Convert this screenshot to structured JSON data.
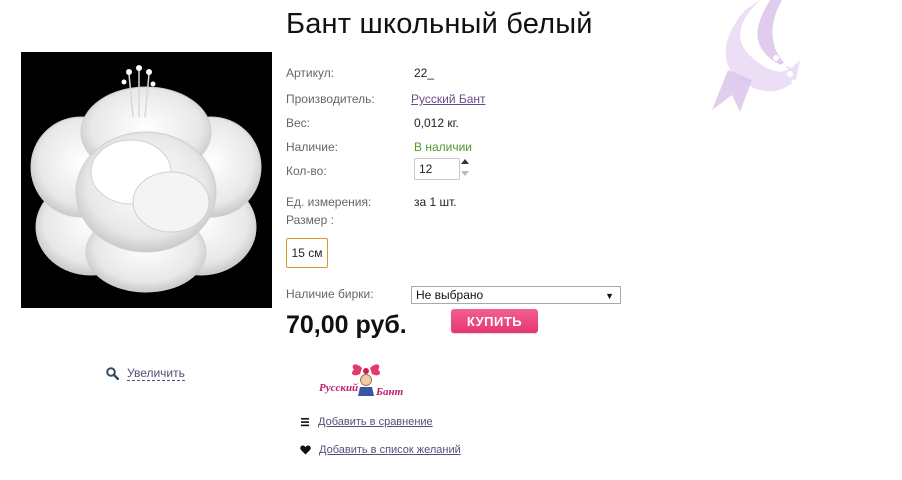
{
  "product": {
    "title": "Бант школьный белый",
    "zoom_label": "Увеличить",
    "props": {
      "article_label": "Артикул:",
      "article_value": "22_",
      "maker_label": "Производитель:",
      "maker_value": "Русский Бант",
      "weight_label": "Вес:",
      "weight_value": "0,012 кг.",
      "availability_label": "Наличие:",
      "availability_value": "В наличии",
      "qty_label": "Кол-во:",
      "qty_value": "12",
      "unit_label": "Ед. измерения:",
      "unit_value": "за 1 шт.",
      "size_label": "Размер :"
    },
    "size_option": "15 см",
    "tag_label": "Наличие бирки:",
    "tag_select_value": "Не выбрано",
    "price": "70,00 руб.",
    "buy_label": "КУПИТЬ",
    "brand_logo_text": [
      "Русский",
      "Бант"
    ],
    "compare_label": "Добавить в сравнение",
    "wishlist_label": "Добавить в список желаний"
  },
  "colors": {
    "buy_button": "#ec4a80",
    "link": "#6a4c8a",
    "availability": "#4c9a2a",
    "size_border": "#e0952a"
  },
  "icons": [
    "search-icon",
    "list-icon",
    "heart-icon",
    "ribbon-decoration"
  ]
}
